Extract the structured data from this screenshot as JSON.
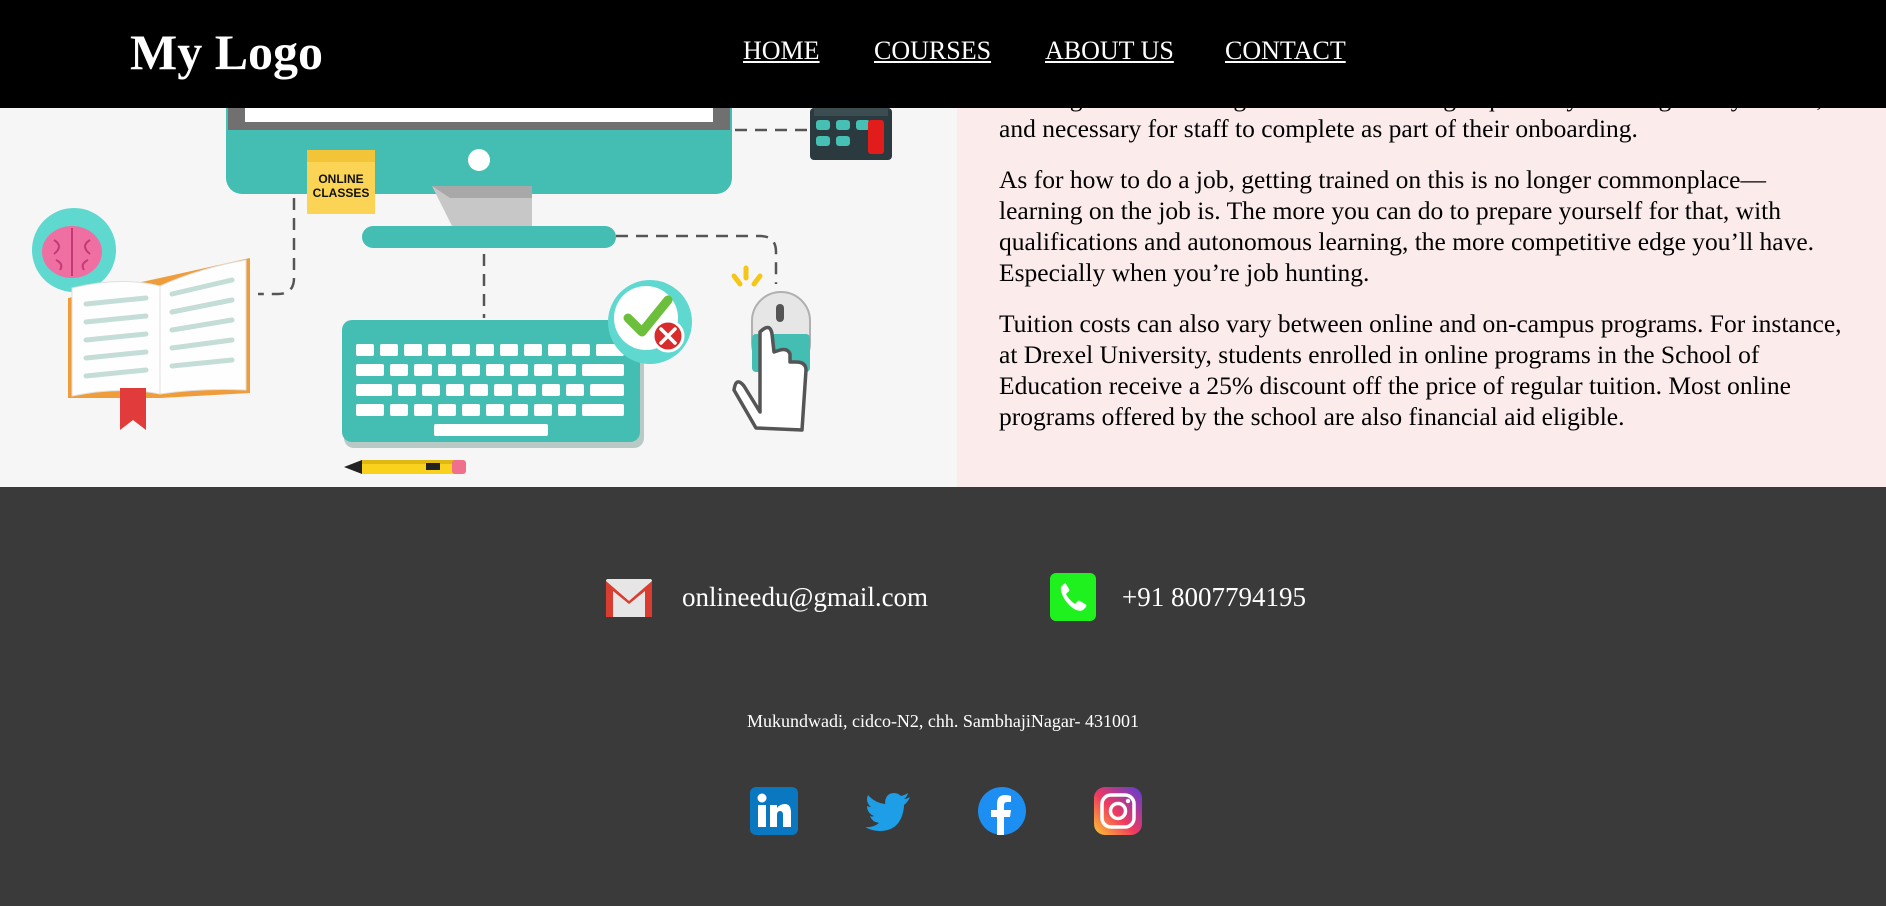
{
  "header": {
    "logo": "My Logo",
    "nav": [
      {
        "label": "HOME",
        "name": "nav-home"
      },
      {
        "label": "COURSES",
        "name": "nav-courses"
      },
      {
        "label": "ABOUT US",
        "name": "nav-about-us"
      },
      {
        "label": "CONTACT",
        "name": "nav-contact"
      }
    ]
  },
  "illustration": {
    "sticky_note": [
      "ONLINE",
      "CLASSES"
    ]
  },
  "content": {
    "paragraphs": [
      "learning as core training. The sort of training required by their regulatory bodies, and necessary for staff to complete as part of their onboarding.",
      "As for how to do a job, getting trained on this is no longer commonplace—learning on the job is. The more you can do to prepare yourself for that, with qualifications and autonomous learning, the more competitive edge you’ll have. Especially when you’re job hunting.",
      "Tuition costs can also vary between online and on-campus programs. For instance, at Drexel University, students enrolled in online programs in the School of Education receive a 25% discount off the price of regular tuition. Most online programs offered by the school are also financial aid eligible."
    ]
  },
  "footer": {
    "email": "onlineedu@gmail.com",
    "phone": "+91 8007794195",
    "address": "Mukundwadi, cidco-N2, chh. SambhajiNagar- 431001",
    "social": [
      "linkedin-icon",
      "twitter-icon",
      "facebook-icon",
      "instagram-icon"
    ],
    "colors": {
      "background": "#3a3a3a",
      "header": "#000000",
      "content_bg": "#fbeceb"
    }
  }
}
